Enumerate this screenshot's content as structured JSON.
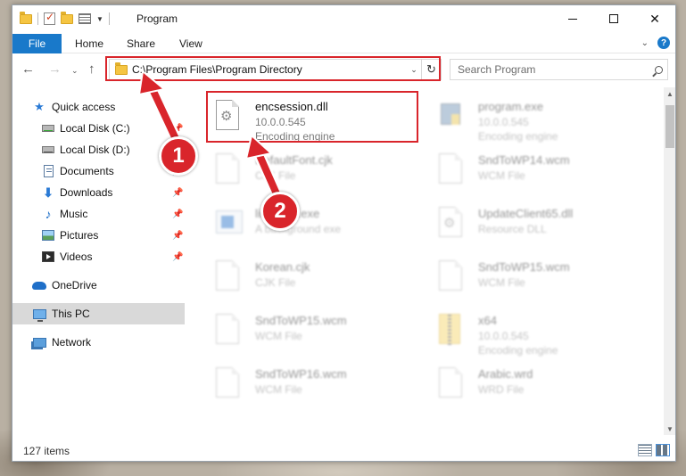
{
  "window": {
    "title": "Program"
  },
  "ribbon": {
    "tabs": [
      "File",
      "Home",
      "Share",
      "View"
    ]
  },
  "address": {
    "path": "C:\\Program Files\\Program Directory"
  },
  "search": {
    "placeholder": "Search Program"
  },
  "sidebar": {
    "items": [
      {
        "label": "Quick access",
        "icon": "star-icon",
        "pinned": false
      },
      {
        "label": "Local Disk (C:)",
        "icon": "drive-icon",
        "pinned": true
      },
      {
        "label": "Local Disk (D:)",
        "icon": "drive-icon",
        "pinned": false
      },
      {
        "label": "Documents",
        "icon": "documents-icon",
        "pinned": true
      },
      {
        "label": "Downloads",
        "icon": "download-icon",
        "pinned": true
      },
      {
        "label": "Music",
        "icon": "music-icon",
        "pinned": true
      },
      {
        "label": "Pictures",
        "icon": "pictures-icon",
        "pinned": true
      },
      {
        "label": "Videos",
        "icon": "videos-icon",
        "pinned": true
      },
      {
        "label": "OneDrive",
        "icon": "cloud-icon",
        "pinned": false
      },
      {
        "label": "This PC",
        "icon": "computer-icon",
        "pinned": false,
        "selected": true
      },
      {
        "label": "Network",
        "icon": "network-icon",
        "pinned": false
      }
    ]
  },
  "files": [
    {
      "name": "encsession.dll",
      "line2": "10.0.0.545",
      "line3": "Encoding engine",
      "icon": "dll-icon",
      "highlighted": true
    },
    {
      "name": "program.exe",
      "line2": "10.0.0.545",
      "line3": "Encoding engine",
      "icon": "program-icon"
    },
    {
      "name": "DefaultFont.cjk",
      "line2": "CJK File",
      "line3": "",
      "icon": "file-icon"
    },
    {
      "name": "SndToWP14.wcm",
      "line2": "WCM File",
      "line3": "",
      "icon": "file-icon"
    },
    {
      "name": "linkedoc.exe",
      "line2": "A background exe",
      "line3": "",
      "icon": "exe-icon"
    },
    {
      "name": "UpdateClient65.dll",
      "line2": "Resource DLL",
      "line3": "",
      "icon": "dll-icon"
    },
    {
      "name": "Korean.cjk",
      "line2": "CJK File",
      "line3": "",
      "icon": "file-icon"
    },
    {
      "name": "SndToWP15.wcm",
      "line2": "WCM File",
      "line3": "",
      "icon": "file-icon"
    },
    {
      "name": "SndToWP15.wcm",
      "line2": "WCM File",
      "line3": "",
      "icon": "file-icon"
    },
    {
      "name": "x64",
      "line2": "10.0.0.545",
      "line3": "Encoding engine",
      "icon": "zip-folder-icon"
    },
    {
      "name": "SndToWP16.wcm",
      "line2": "WCM File",
      "line3": "",
      "icon": "file-icon"
    },
    {
      "name": "Arabic.wrd",
      "line2": "WRD File",
      "line3": "",
      "icon": "file-icon"
    }
  ],
  "status": {
    "count": "127 items"
  },
  "callouts": [
    "1",
    "2"
  ],
  "colors": {
    "accent": "#1979ca",
    "highlight": "#d9252b"
  }
}
